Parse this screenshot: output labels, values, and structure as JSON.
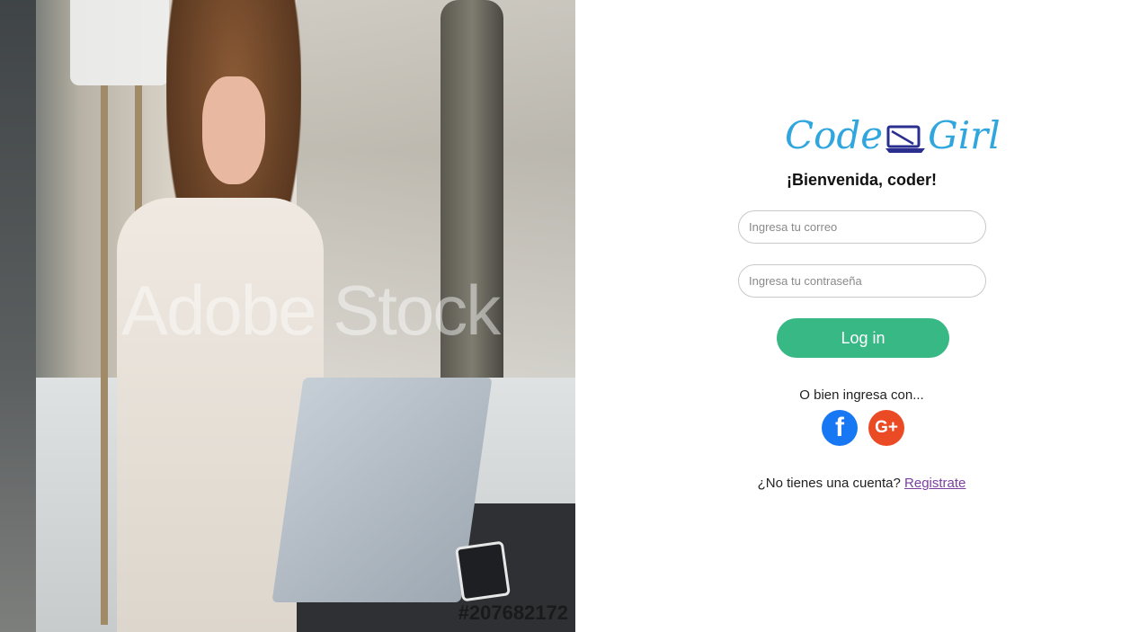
{
  "photo": {
    "watermark_text": "Adobe Stock",
    "stock_id": "#207682172"
  },
  "logo": {
    "left_text": "Code",
    "right_text": "Girl",
    "icon": "laptop-icon",
    "color": "#2fa6dd"
  },
  "welcome": "¡Bienvenida, coder!",
  "form": {
    "email_placeholder": "Ingresa tu correo",
    "password_placeholder": "Ingresa tu contraseña",
    "login_label": "Log in",
    "login_color": "#38b885"
  },
  "alt_login": {
    "text": "O bien ingresa con...",
    "providers": [
      {
        "name": "facebook",
        "icon": "facebook-icon",
        "glyph": "f",
        "color": "#1877f2"
      },
      {
        "name": "google-plus",
        "icon": "google-plus-icon",
        "glyph": "G+",
        "color": "#ea4b25"
      }
    ]
  },
  "signup": {
    "prompt": "¿No tienes una cuenta?",
    "link_label": "Registrate",
    "link_color": "#7a3fa0"
  }
}
